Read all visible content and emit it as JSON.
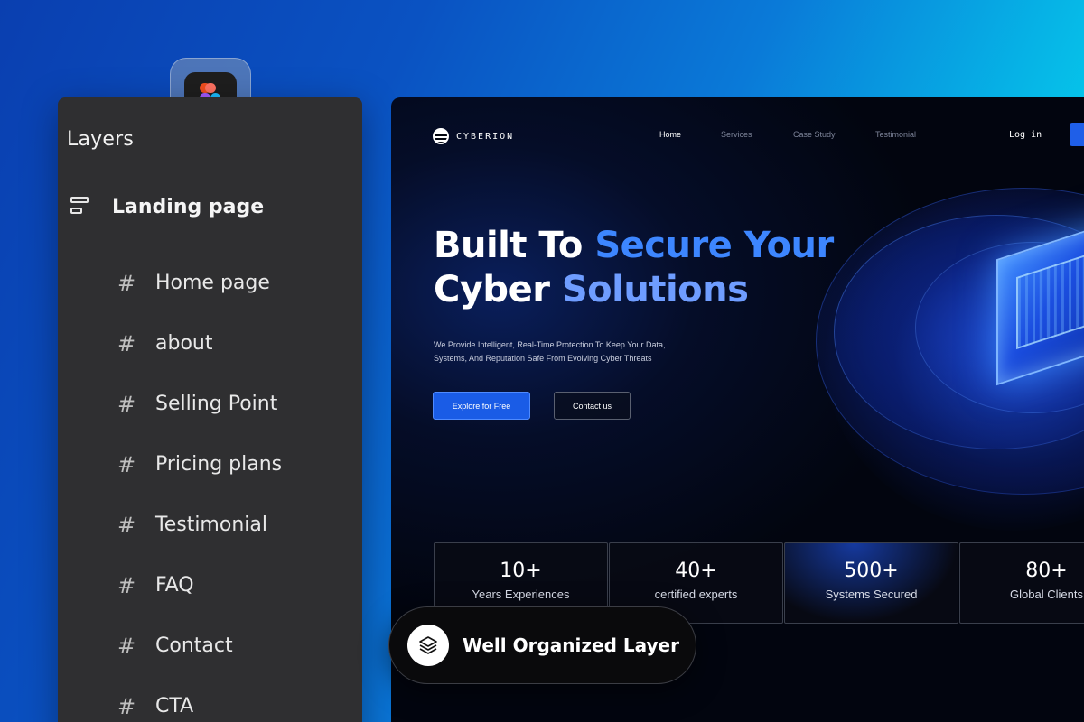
{
  "layers": {
    "title": "Layers",
    "root": "Landing page",
    "items": [
      "Home page",
      "about",
      "Selling Point",
      "Pricing plans",
      "Testimonial",
      "FAQ",
      "Contact",
      "CTA"
    ]
  },
  "website": {
    "brand": "CYBERION",
    "nav": {
      "links": [
        "Home",
        "Services",
        "Case Study",
        "Testimonial"
      ],
      "login": "Log in"
    },
    "hero": {
      "line1_white": "Built To ",
      "line1_blue": "Secure Your",
      "line2_white": "Cyber ",
      "line2_blue": "Solutions",
      "subtitle_line1": "We Provide Intelligent, Real-Time Protection To Keep Your Data,",
      "subtitle_line2": "Systems, And Reputation Safe From Evolving Cyber Threats",
      "primary_cta": "Explore for Free",
      "secondary_cta": "Contact us"
    },
    "stats": [
      {
        "value": "10+",
        "label": "Years Experiences"
      },
      {
        "value": "40+",
        "label": "certified experts"
      },
      {
        "value": "500+",
        "label": "Systems Secured"
      },
      {
        "value": "80+",
        "label": "Global Clients"
      }
    ]
  },
  "badge": {
    "label": "Well Organized Layer",
    "icon": "layers-icon"
  },
  "colors": {
    "accent": "#1a5ce6",
    "panel": "#2f2f31",
    "hero_blue": "#6f9dff"
  }
}
